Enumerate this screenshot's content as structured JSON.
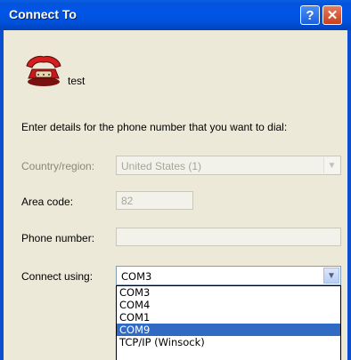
{
  "window": {
    "title": "Connect To",
    "help_glyph": "?",
    "close_glyph": "✕"
  },
  "connection": {
    "name": "test",
    "icon": "phone-icon"
  },
  "prompt": "Enter details for the phone number that you want to dial:",
  "fields": {
    "country_label": "Country/region:",
    "country_value": "United States (1)",
    "area_code_label": "Area code:",
    "area_code_value": "82",
    "phone_label": "Phone number:",
    "phone_value": "",
    "connect_using_label": "Connect using:",
    "connect_using_value": "COM3"
  },
  "dropdown": {
    "options": [
      "COM3",
      "COM4",
      "COM1",
      "COM9",
      "TCP/IP (Winsock)"
    ],
    "highlighted": "COM9"
  },
  "colors": {
    "titlebar": "#0054e3",
    "dialog_bg": "#ece9d8",
    "highlight": "#316ac5"
  }
}
